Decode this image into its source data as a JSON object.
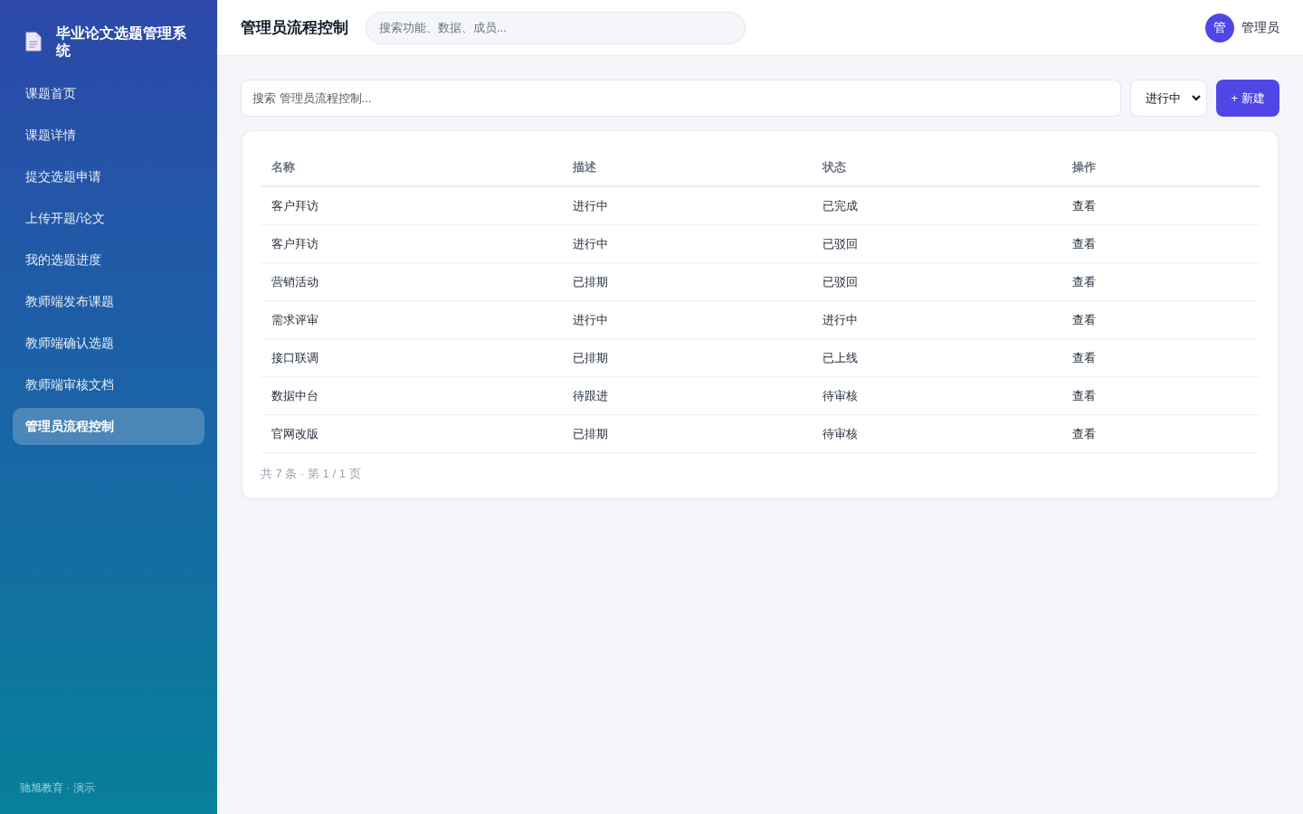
{
  "sidebar": {
    "brand": {
      "title": "毕业论文选题管理系统"
    },
    "items": [
      {
        "label": "课题首页",
        "selected": false
      },
      {
        "label": "课题详情",
        "selected": false
      },
      {
        "label": "提交选题申请",
        "selected": false
      },
      {
        "label": "上传开题/论文",
        "selected": false
      },
      {
        "label": "我的选题进度",
        "selected": false
      },
      {
        "label": "教师端发布课题",
        "selected": false
      },
      {
        "label": "教师端确认选题",
        "selected": false
      },
      {
        "label": "教师端审核文档",
        "selected": false
      },
      {
        "label": "管理员流程控制",
        "selected": true
      }
    ],
    "footer": "驰旭教育 · 演示"
  },
  "topbar": {
    "title": "管理员流程控制",
    "search": {
      "placeholder": "搜索功能、数据、成员..."
    },
    "user": {
      "avatar": "管",
      "name": "管理员"
    }
  },
  "toolbar": {
    "search": {
      "placeholder": "搜索 管理员流程控制..."
    },
    "filter": {
      "value": "进行中"
    },
    "create_button": "+ 新建"
  },
  "table": {
    "columns": [
      "名称",
      "描述",
      "状态",
      "操作"
    ],
    "rows": [
      {
        "cells": [
          "客户拜访",
          "进行中",
          "已完成"
        ],
        "action": "查看"
      },
      {
        "cells": [
          "客户拜访",
          "进行中",
          "已驳回"
        ],
        "action": "查看"
      },
      {
        "cells": [
          "营销活动",
          "已排期",
          "已驳回"
        ],
        "action": "查看"
      },
      {
        "cells": [
          "需求评审",
          "进行中",
          "进行中"
        ],
        "action": "查看"
      },
      {
        "cells": [
          "接口联调",
          "已排期",
          "已上线"
        ],
        "action": "查看"
      },
      {
        "cells": [
          "数据中台",
          "待跟进",
          "待审核"
        ],
        "action": "查看"
      },
      {
        "cells": [
          "官网改版",
          "已排期",
          "待审核"
        ],
        "action": "查看"
      }
    ]
  },
  "pagination": "共 7 条 · 第 1 / 1 页"
}
